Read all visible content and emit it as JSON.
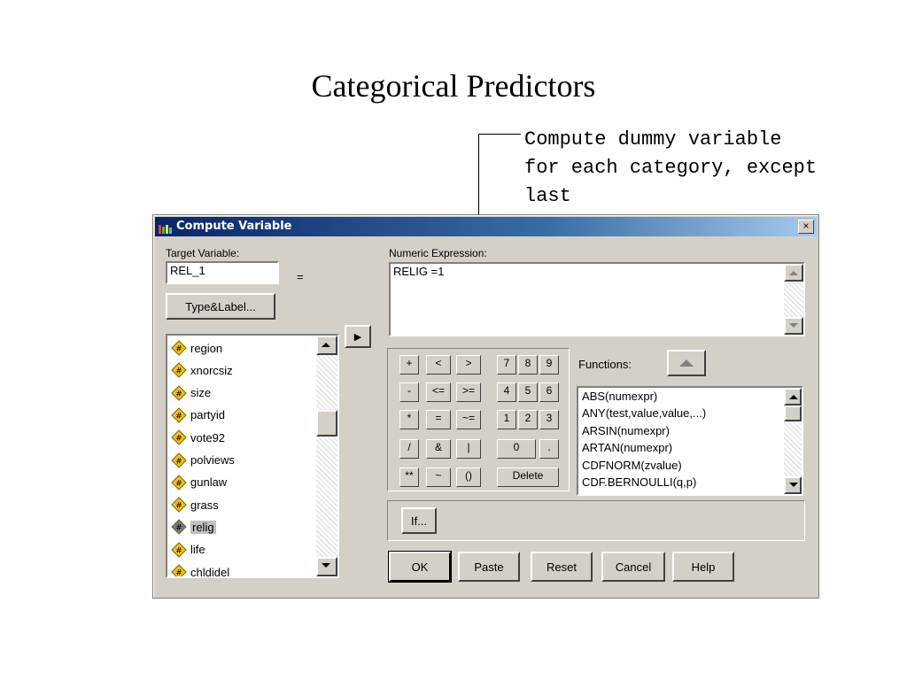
{
  "slide": {
    "title": "Categorical Predictors",
    "callout": [
      "Compute dummy variable",
      "for each category, except",
      "last"
    ]
  },
  "dialog": {
    "title": "Compute Variable",
    "close_label": "×",
    "target_variable_label": "Target Variable:",
    "target_variable_value": "REL_1",
    "equals_sign": "=",
    "type_label_button": "Type&Label...",
    "numeric_expression_label": "Numeric Expression:",
    "numeric_expression_value": "RELIG =1",
    "move_arrow": "▶",
    "functions_label": "Functions:",
    "if_button": "If...",
    "variables": [
      {
        "name": "region",
        "icon": "scale-variable-icon",
        "selected": false
      },
      {
        "name": "xnorcsiz",
        "icon": "scale-variable-icon",
        "selected": false
      },
      {
        "name": "size",
        "icon": "scale-variable-icon",
        "selected": false
      },
      {
        "name": "partyid",
        "icon": "scale-variable-icon",
        "selected": false
      },
      {
        "name": "vote92",
        "icon": "scale-variable-icon",
        "selected": false
      },
      {
        "name": "polviews",
        "icon": "scale-variable-icon",
        "selected": false
      },
      {
        "name": "gunlaw",
        "icon": "scale-variable-icon",
        "selected": false
      },
      {
        "name": "grass",
        "icon": "scale-variable-icon",
        "selected": false
      },
      {
        "name": "relig",
        "icon": "scale-variable-icon",
        "selected": true
      },
      {
        "name": "life",
        "icon": "scale-variable-icon",
        "selected": false
      },
      {
        "name": "chldidel",
        "icon": "scale-variable-icon",
        "selected": false
      }
    ],
    "keypad": [
      [
        "+",
        "<",
        ">",
        "7",
        "8",
        "9"
      ],
      [
        "-",
        "<=",
        ">=",
        "4",
        "5",
        "6"
      ],
      [
        "*",
        "=",
        "~=",
        "1",
        "2",
        "3"
      ],
      [
        "/",
        "&",
        "|",
        "0",
        "."
      ],
      [
        "**",
        "~",
        "()",
        "Delete"
      ]
    ],
    "functions": [
      "ABS(numexpr)",
      "ANY(test,value,value,...)",
      "ARSIN(numexpr)",
      "ARTAN(numexpr)",
      "CDFNORM(zvalue)",
      "CDF.BERNOULLI(q,p)"
    ],
    "buttons": {
      "ok": "OK",
      "paste": "Paste",
      "reset": "Reset",
      "cancel": "Cancel",
      "help": "Help"
    },
    "colors": {
      "titlebar_start": "#0a246a",
      "titlebar_end": "#a6caf0",
      "face": "#d4d0c8"
    }
  }
}
